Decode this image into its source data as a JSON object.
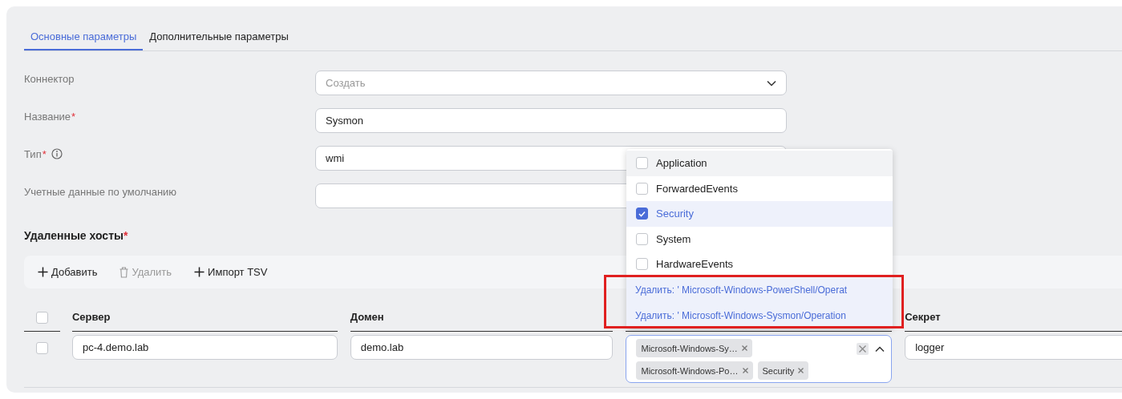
{
  "tabs": [
    {
      "label": "Основные параметры",
      "selected": true
    },
    {
      "label": "Дополнительные параметры",
      "selected": false
    }
  ],
  "form": [
    {
      "label": "Коннектор",
      "kind": "select",
      "placeholder": "Создать"
    },
    {
      "label": "Название",
      "required_mark": "*",
      "kind": "text",
      "value": "Sysmon"
    },
    {
      "label": "Тип",
      "required_mark": "*",
      "info": true,
      "kind": "text",
      "value": "wmi"
    },
    {
      "label": "Учетные данные по умолчанию",
      "kind": "text"
    }
  ],
  "hosts": {
    "title": "Удаленные хосты",
    "required_mark": "*",
    "toolbar": [
      {
        "label": "Добавить",
        "kind": "add",
        "disabled": false
      },
      {
        "label": "Удалить",
        "kind": "delete",
        "disabled": true
      },
      {
        "label": "Импорт TSV",
        "kind": "add",
        "disabled": false
      }
    ],
    "header_checked": false,
    "column_headers": {
      "server": "Сервер",
      "domain": "Домен",
      "secret": "Секрет"
    },
    "rows": [
      {
        "checked": false,
        "server": "pc-4.demo.lab",
        "domain": "demo.lab",
        "column_3_tags": [
          "Microsoft-Windows-Sy…",
          "Microsoft-Windows-Po…",
          "Security"
        ],
        "secret": "logger"
      }
    ]
  },
  "dropdown": {
    "options": [
      {
        "label": "Application",
        "checked": false,
        "hovered": true
      },
      {
        "label": "ForwardedEvents",
        "checked": false,
        "hovered": false
      },
      {
        "label": "Security",
        "checked": true,
        "hovered": false
      },
      {
        "label": "System",
        "checked": false,
        "hovered": false
      },
      {
        "label": "HardwareEvents",
        "checked": false,
        "hovered": false
      }
    ],
    "remove_actions": [
      "Удалить: ' Microsoft-Windows-PowerShell/Operat",
      "Удалить: ' Microsoft-Windows-Sysmon/Operation"
    ]
  }
}
